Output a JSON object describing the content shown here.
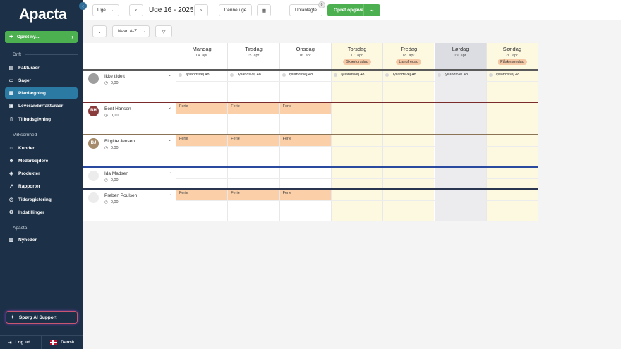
{
  "brand": {
    "logo": "Apacta"
  },
  "sidebar": {
    "create_label": "Opret ny...",
    "sections": [
      {
        "title": "Drift",
        "items": [
          "Fakturaer",
          "Sager",
          "Planlægning",
          "Leverandørfakturaer",
          "Tilbudsgivning"
        ]
      },
      {
        "title": "Virksomhed",
        "items": [
          "Kunder",
          "Medarbejdere",
          "Produkter",
          "Rapporter",
          "Tidsregistering",
          "Indstillinger"
        ]
      },
      {
        "title": "Apacta",
        "items": [
          "Nyheder"
        ]
      }
    ],
    "active_item": "Planlægning",
    "ai_label": "Spørg AI Support",
    "logout_label": "Log ud",
    "language_label": "Dansk"
  },
  "toolbar": {
    "view_select": "Uge",
    "prev_icon": "chevron-left-icon",
    "week_title": "Uge 16 - 2025",
    "next_icon": "chevron-right-icon",
    "today_label": "Denne uge",
    "unplanned_label": "Uplanlagte",
    "unplanned_count": "0",
    "create_task_label": "Opret opgave"
  },
  "filters": {
    "sort_select": "Navn A-Z"
  },
  "days": [
    {
      "name": "Mandag",
      "date": "14. apr.",
      "holiday": ""
    },
    {
      "name": "Tirsdag",
      "date": "15. apr.",
      "holiday": ""
    },
    {
      "name": "Onsdag",
      "date": "16. apr.",
      "holiday": ""
    },
    {
      "name": "Torsdag",
      "date": "17. apr.",
      "holiday": "Skærtorsdag"
    },
    {
      "name": "Fredag",
      "date": "18. apr.",
      "holiday": "Langfredag"
    },
    {
      "name": "Lørdag",
      "date": "19. apr.",
      "holiday": ""
    },
    {
      "name": "Søndag",
      "date": "20. apr.",
      "holiday": "Påskesøndag"
    }
  ],
  "rows": [
    {
      "name": "Ikke tildelt",
      "initials": "",
      "avatar_color": "#9e9e9e",
      "hours": "0,00",
      "line_color": "#5a5a5a",
      "address": "Jyllandsvej 48",
      "ferie_days": []
    },
    {
      "name": "Bent Hansen",
      "initials": "BH",
      "avatar_color": "#8a3b3b",
      "hours": "0,00",
      "line_color": "#7a2b2b",
      "ferie_days": [
        0,
        1,
        2
      ],
      "ferie_label": "Ferie"
    },
    {
      "name": "Birgitte Jensen",
      "initials": "BJ",
      "avatar_color": "#a68b6a",
      "hours": "0,00",
      "line_color": "#8b7355",
      "ferie_days": [
        0,
        1,
        2
      ],
      "ferie_label": "Ferie"
    },
    {
      "name": "Ida Madsen",
      "initials": "",
      "avatar_color": "#ececec",
      "hours": "0,00",
      "line_color": "#2a4aa0",
      "ferie_days": []
    },
    {
      "name": "Preben Poulsen",
      "initials": "",
      "avatar_color": "#ececec",
      "hours": "0,00",
      "line_color": "#2a3550",
      "ferie_days": [
        0,
        1,
        2
      ],
      "ferie_label": "Ferie"
    }
  ],
  "colors": {
    "sidebar_bg": "#1c3047",
    "active_nav": "#2a7aa3",
    "primary_green": "#4caf50",
    "holiday_bg": "#fdf9e1",
    "weekend_bg": "#ececee",
    "ferie_bg": "#fbd0a8"
  }
}
